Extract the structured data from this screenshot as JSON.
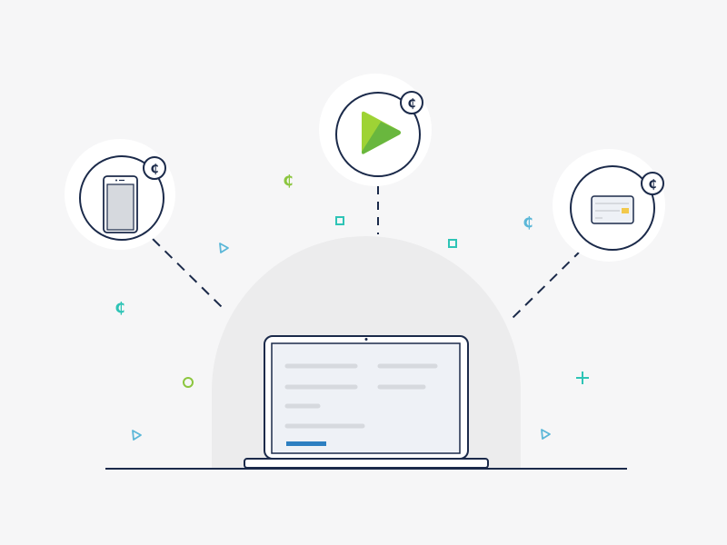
{
  "currency_symbol": "₵",
  "colors": {
    "background": "#f6f6f7",
    "dome": "#ececed",
    "outline": "#1b2a4a",
    "teal": "#2ec4b6",
    "green": "#8cc63f",
    "light_blue": "#5bb7d8",
    "accent_bar": "#2d7fc1",
    "screen": "#eef1f6",
    "placeholder": "#d6d9de",
    "card_chip": "#f2c94c",
    "play_green": "#9ed335",
    "play_dark": "#5fb23f"
  },
  "icons": {
    "phone": "smartphone-icon",
    "play": "play-store-icon",
    "card": "credit-card-icon",
    "laptop": "laptop-icon"
  }
}
